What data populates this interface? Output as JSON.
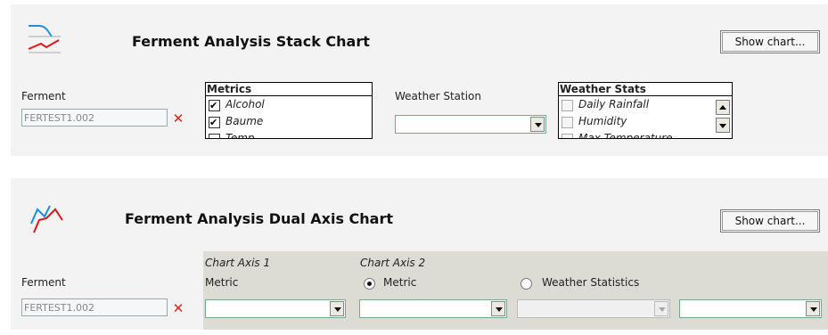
{
  "stack": {
    "title": "Ferment Analysis Stack Chart",
    "show_chart": "Show chart...",
    "ferment_label": "Ferment",
    "ferment_value": "FERTEST1.002",
    "metrics": {
      "header": "Metrics",
      "items": [
        {
          "label": "Alcohol",
          "checked": true
        },
        {
          "label": "Baume",
          "checked": true
        },
        {
          "label": "Temp",
          "checked": false
        }
      ]
    },
    "weather_station_label": "Weather Station",
    "weather_station_value": "",
    "weather_stats": {
      "header": "Weather Stats",
      "items": [
        {
          "label": "Daily Rainfall",
          "checked": false
        },
        {
          "label": "Humidity",
          "checked": false
        },
        {
          "label": "Max Temperature",
          "checked": false
        }
      ]
    }
  },
  "dual": {
    "title": "Ferment Analysis Dual Axis Chart",
    "show_chart": "Show chart...",
    "ferment_label": "Ferment",
    "ferment_value": "FERTEST1.002",
    "axis1_label": "Chart Axis 1",
    "axis1_metric_label": "Metric",
    "axis2_label": "Chart Axis 2",
    "axis2_metric_label": "Metric",
    "axis2_weather_label": "Weather Statistics",
    "axis2_selected": "Metric"
  },
  "icons": {
    "stack_icon": "stack-chart-icon",
    "dual_icon": "dual-axis-chart-icon",
    "clear": "clear-x-icon"
  }
}
